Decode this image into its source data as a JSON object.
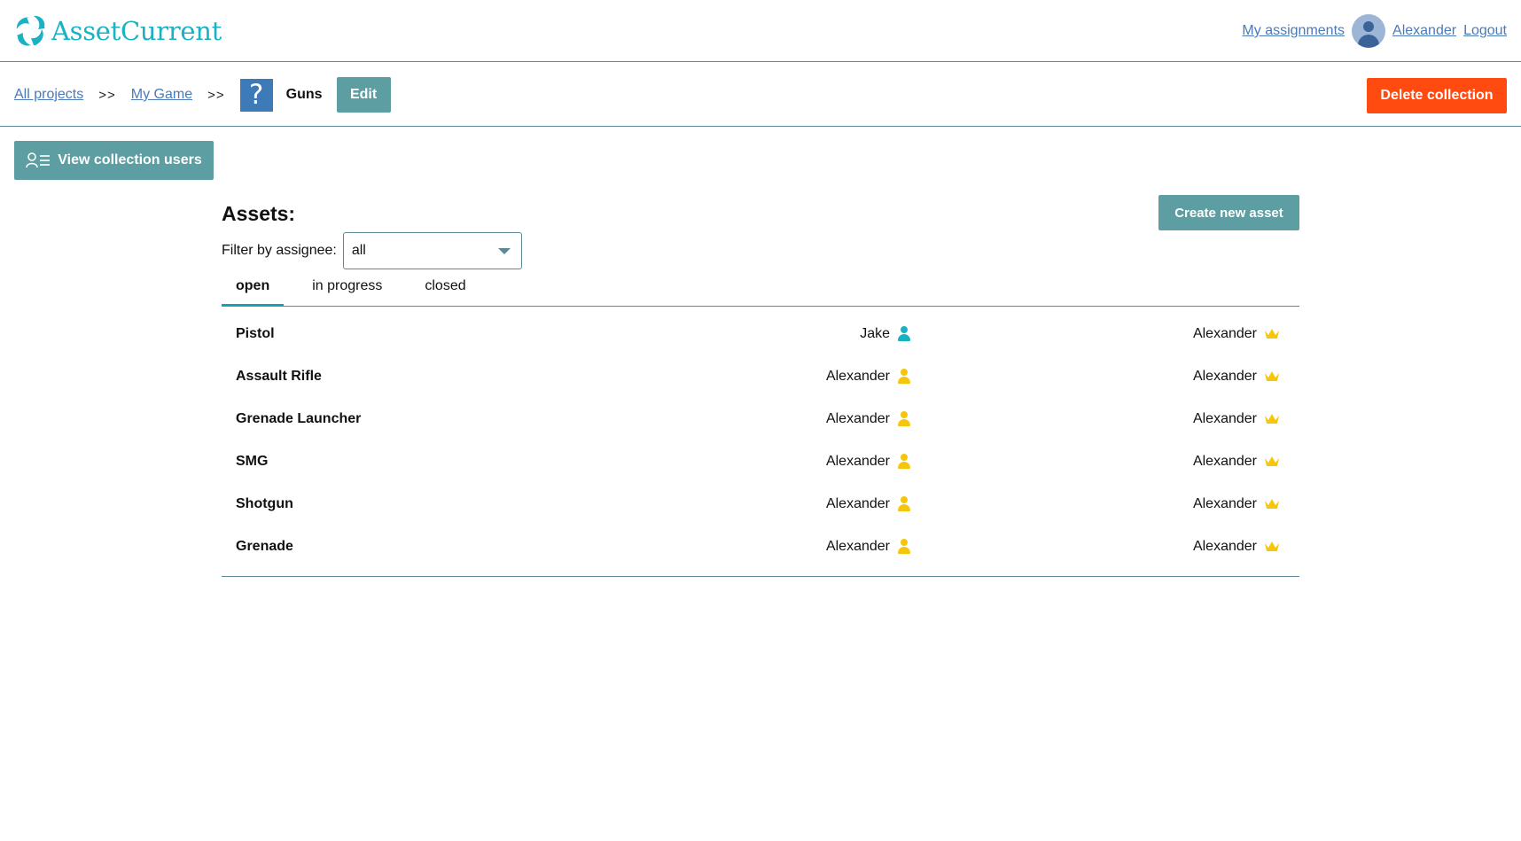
{
  "colors": {
    "brand": "#18b2c4",
    "primary_button": "#5c9ea2",
    "danger_button": "#ff4a10",
    "link": "#4a7ab8",
    "assignee_other": "#18b2c4",
    "assignee_self": "#f5c60c",
    "owner_crown": "#f5c60c"
  },
  "header": {
    "brand_name": "AssetCurrent",
    "my_assignments": "My assignments",
    "user_name": "Alexander",
    "logout": "Logout"
  },
  "breadcrumb": {
    "all_projects": "All projects",
    "separator": ">>",
    "project": "My Game",
    "collection_icon": "?",
    "current": "Guns",
    "edit_label": "Edit",
    "delete_label": "Delete collection"
  },
  "view_users_label": "View collection users",
  "assets": {
    "title": "Assets:",
    "create_label": "Create new asset",
    "filter_label": "Filter by assignee:",
    "filter_value": "all",
    "tabs": [
      "open",
      "in progress",
      "closed"
    ],
    "active_tab": "open",
    "rows": [
      {
        "name": "Pistol",
        "assignee": "Jake",
        "assignee_icon": "person-icon-teal",
        "owner": "Alexander",
        "owner_icon": "crown-icon"
      },
      {
        "name": "Assault Rifle",
        "assignee": "Alexander",
        "assignee_icon": "person-icon-yellow",
        "owner": "Alexander",
        "owner_icon": "crown-icon"
      },
      {
        "name": "Grenade Launcher",
        "assignee": "Alexander",
        "assignee_icon": "person-icon-yellow",
        "owner": "Alexander",
        "owner_icon": "crown-icon"
      },
      {
        "name": "SMG",
        "assignee": "Alexander",
        "assignee_icon": "person-icon-yellow",
        "owner": "Alexander",
        "owner_icon": "crown-icon"
      },
      {
        "name": "Shotgun",
        "assignee": "Alexander",
        "assignee_icon": "person-icon-yellow",
        "owner": "Alexander",
        "owner_icon": "crown-icon"
      },
      {
        "name": "Grenade",
        "assignee": "Alexander",
        "assignee_icon": "person-icon-yellow",
        "owner": "Alexander",
        "owner_icon": "crown-icon"
      }
    ]
  }
}
